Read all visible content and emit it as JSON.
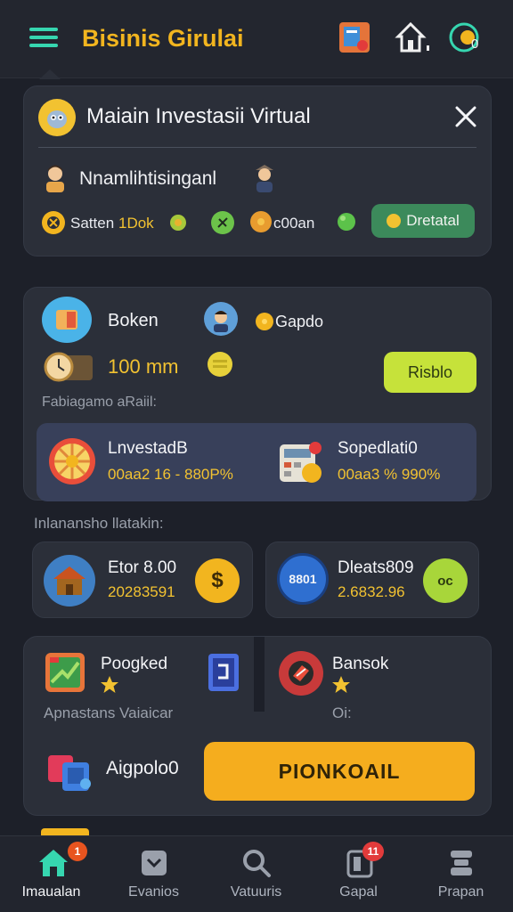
{
  "header": {
    "title": "Bisinis Girulai"
  },
  "modal": {
    "title": "Maiain Investasii Virtual",
    "subtitle": "Nnamlihtisinganl",
    "stats": {
      "label": "Satten",
      "value": "1Dok",
      "coin_value": "c00an"
    },
    "button": "Dretatal"
  },
  "business": {
    "name": "Boken",
    "coin_label": "Gapdo",
    "amount": "100 mm",
    "action_button": "Risblo",
    "caption": "Fabiagamo aRaiil:",
    "investments": [
      {
        "name": "LnvestadB",
        "range": "00aa2 16 - 880P%"
      },
      {
        "name": "Sopedlati0",
        "range": "00aa3 % 990%"
      }
    ]
  },
  "section_label": "Inlanansho llatakin:",
  "assets": [
    {
      "name": "Etor 8.00",
      "value": "20283591",
      "badge": "$"
    },
    {
      "name": "Dleats809",
      "value": "2.6832.96",
      "badge": "oc",
      "icon_text": "8801"
    }
  ],
  "projects": [
    {
      "name": "Poogked",
      "caption": "Apnastans Vaiaicar"
    },
    {
      "name": "Bansok",
      "caption": "Oi:"
    }
  ],
  "group": {
    "name": "Aigpolo0",
    "button": "PIONKOAIL"
  },
  "nav": [
    {
      "label": "Imaualan",
      "badge": "1"
    },
    {
      "label": "Evanios"
    },
    {
      "label": "Vatuuris"
    },
    {
      "label": "Gapal",
      "badge": "11"
    },
    {
      "label": "Prapan"
    }
  ],
  "colors": {
    "accent_yellow": "#f2b51f",
    "accent_green": "#8fcf3a",
    "teal": "#36d6b0",
    "background": "#1d2029"
  }
}
